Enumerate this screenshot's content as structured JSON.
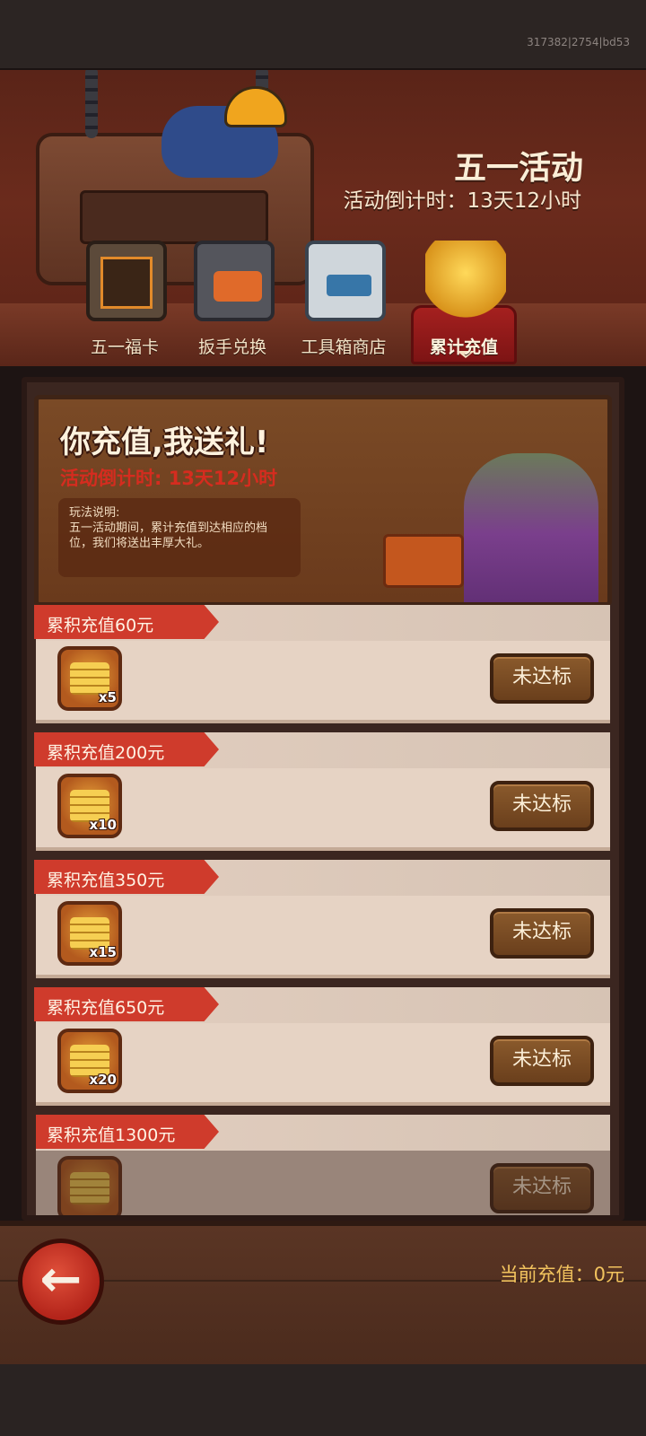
{
  "build_id": "317382|2754|bd53",
  "header": {
    "title": "五一活动",
    "countdown": "活动倒计时：13天12小时"
  },
  "tabs": [
    {
      "label": "五一福卡",
      "icon": "card-box-icon",
      "active": false
    },
    {
      "label": "扳手兑换",
      "icon": "wrench-chest-icon",
      "active": false
    },
    {
      "label": "工具箱商店",
      "icon": "toolbox-icon",
      "active": false
    },
    {
      "label": "累计充值",
      "icon": "gold-trophy-icon",
      "active": true
    }
  ],
  "banner": {
    "title": "你充值,我送礼!",
    "countdown": "活动倒计时: 13天12小时",
    "rules_heading": "玩法说明:",
    "rules_text": "五一活动期间，累计充值到达相应的档位，我们将送出丰厚大礼。"
  },
  "rewards": [
    {
      "tier": "累积充值60元",
      "item_icon": "gold-bars-icon",
      "quantity": "x5",
      "status": "未达标"
    },
    {
      "tier": "累积充值200元",
      "item_icon": "gold-bars-icon",
      "quantity": "x10",
      "status": "未达标"
    },
    {
      "tier": "累积充值350元",
      "item_icon": "gold-bars-icon",
      "quantity": "x15",
      "status": "未达标"
    },
    {
      "tier": "累积充值650元",
      "item_icon": "gold-bars-icon",
      "quantity": "x20",
      "status": "未达标"
    },
    {
      "tier": "累积充值1300元",
      "item_icon": "gold-bars-icon",
      "quantity": "",
      "status": "未达标"
    }
  ],
  "footer": {
    "back_icon": "back-arrow-icon",
    "current_charge": "当前充值：0元"
  },
  "colors": {
    "accent_red": "#cf3b2c",
    "gold_text": "#f2c35e",
    "countdown_red": "#d52c1f"
  }
}
